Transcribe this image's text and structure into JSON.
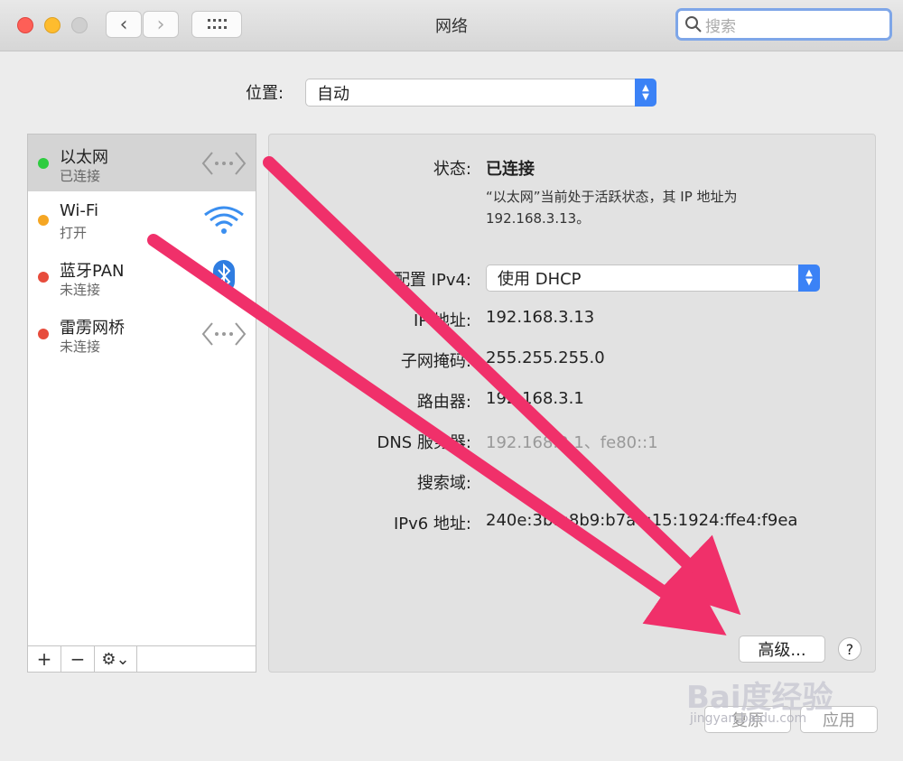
{
  "window": {
    "title": "网络"
  },
  "toolbar": {
    "back": "‹",
    "forward": "›",
    "grid": "⠿"
  },
  "search": {
    "placeholder": "搜索"
  },
  "location": {
    "label": "位置:",
    "value": "自动"
  },
  "services": [
    {
      "name": "以太网",
      "status": "已连接",
      "dot": "#2ecc40",
      "icon": "ethernet-icon"
    },
    {
      "name": "Wi-Fi",
      "status": "打开",
      "dot": "#f5a623",
      "icon": "wifi-icon"
    },
    {
      "name": "蓝牙PAN",
      "status": "未连接",
      "dot": "#e74c3c",
      "icon": "bluetooth-icon"
    },
    {
      "name": "雷雳网桥",
      "status": "未连接",
      "dot": "#e74c3c",
      "icon": "ethernet-icon"
    }
  ],
  "sidebar_toolbar": {
    "add": "+",
    "remove": "−",
    "gear": "⚙︎⌄"
  },
  "detail": {
    "status_label": "状态:",
    "status_value": "已连接",
    "status_desc": "“以太网”当前处于活跃状态，其 IP 地址为 192.168.3.13。",
    "config_label": "配置 IPv4:",
    "config_value": "使用 DHCP",
    "ip_label": "IP 地址:",
    "ip_value": "192.168.3.13",
    "mask_label": "子网掩码:",
    "mask_value": "255.255.255.0",
    "router_label": "路由器:",
    "router_value": "192.168.3.1",
    "dns_label": "DNS 服务器:",
    "dns_value": "192.168.3.1、fe80::1",
    "search_domain_label": "搜索域:",
    "ipv6_label": "IPv6 地址:",
    "ipv6_value": "240e:3b1:8b9:b7a0:15:1924:ffe4:f9ea",
    "advanced_button": "高级...",
    "help_button": "?"
  },
  "footer": {
    "revert_button": "复原",
    "apply_button": "应用"
  },
  "watermark": {
    "brand": "Bai度经验",
    "url": "jingyan.baidu.com"
  },
  "colors": {
    "accent": "#3b82f6",
    "arrow": "#f0306a"
  }
}
